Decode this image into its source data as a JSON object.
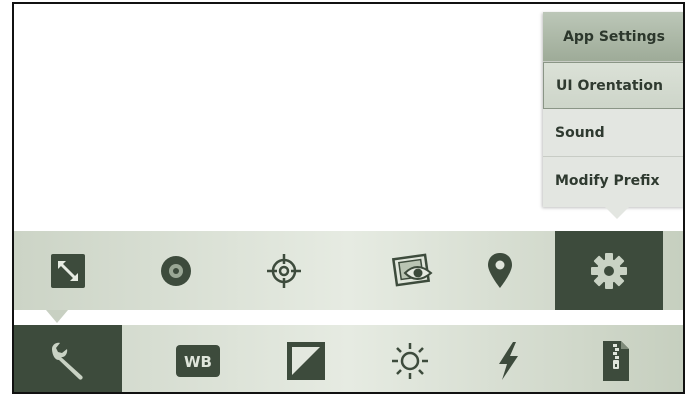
{
  "settings_menu": {
    "title": "App Settings",
    "items": [
      {
        "label": "UI Orentation",
        "active": true
      },
      {
        "label": "Sound",
        "active": false
      },
      {
        "label": "Modify Prefix",
        "active": false
      }
    ]
  },
  "top_toolbar": {
    "buttons": [
      {
        "icon": "resize-arrow-icon"
      },
      {
        "icon": "disc-icon"
      },
      {
        "icon": "crosshair-icon"
      },
      {
        "icon": "photo-eye-icon"
      },
      {
        "icon": "location-pin-icon"
      },
      {
        "icon": "gear-icon",
        "selected": true
      }
    ]
  },
  "bottom_toolbar": {
    "wb_label": "WB",
    "buttons": [
      {
        "icon": "wrench-icon",
        "selected": true
      },
      {
        "icon": "white-balance-icon"
      },
      {
        "icon": "exposure-icon"
      },
      {
        "icon": "brightness-icon"
      },
      {
        "icon": "flash-icon"
      },
      {
        "icon": "zip-file-icon"
      }
    ]
  },
  "colors": {
    "selected_bg": "#3d4b3c",
    "icon_dark": "#3d4b3c",
    "menu_bg": "#e3e6e1",
    "menu_header": "#a9b4a4"
  }
}
